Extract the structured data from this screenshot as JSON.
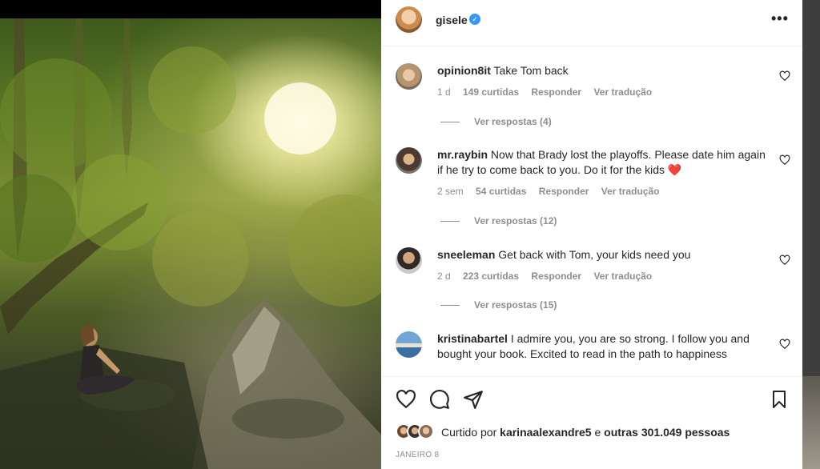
{
  "post": {
    "username": "gisele",
    "more_label": "•••"
  },
  "comments": [
    {
      "username": "opinion8it",
      "text": "Take Tom back",
      "time": "1 d",
      "likes": "149 curtidas",
      "reply": "Responder",
      "translate": "Ver tradução",
      "replies": "Ver respostas (4)"
    },
    {
      "username": "mr.raybin",
      "text": "Now that Brady lost the playoffs. Please date him again if he try to come back to you. Do it for the kids",
      "emoji": "❤️",
      "time": "2 sem",
      "likes": "54 curtidas",
      "reply": "Responder",
      "translate": "Ver tradução",
      "replies": "Ver respostas (12)"
    },
    {
      "username": "sneeleman",
      "text": "Get back with Tom, your kids need you",
      "time": "2 d",
      "likes": "223 curtidas",
      "reply": "Responder",
      "translate": "Ver tradução",
      "replies": "Ver respostas (15)"
    },
    {
      "username": "kristinabartel",
      "text": "I admire you, you are so strong. I follow you and bought your book. Excited to read in the path to happiness"
    }
  ],
  "likes_summary": {
    "prefix": "Curtido por",
    "user": "karinaalexandre5",
    "connector": "e",
    "others": "outras 301.049 pessoas"
  },
  "date": "JANEIRO 8",
  "colors": {
    "verified": "#3897f0",
    "heart": "#ed4956",
    "secondary_text": "#8e8e8e"
  }
}
